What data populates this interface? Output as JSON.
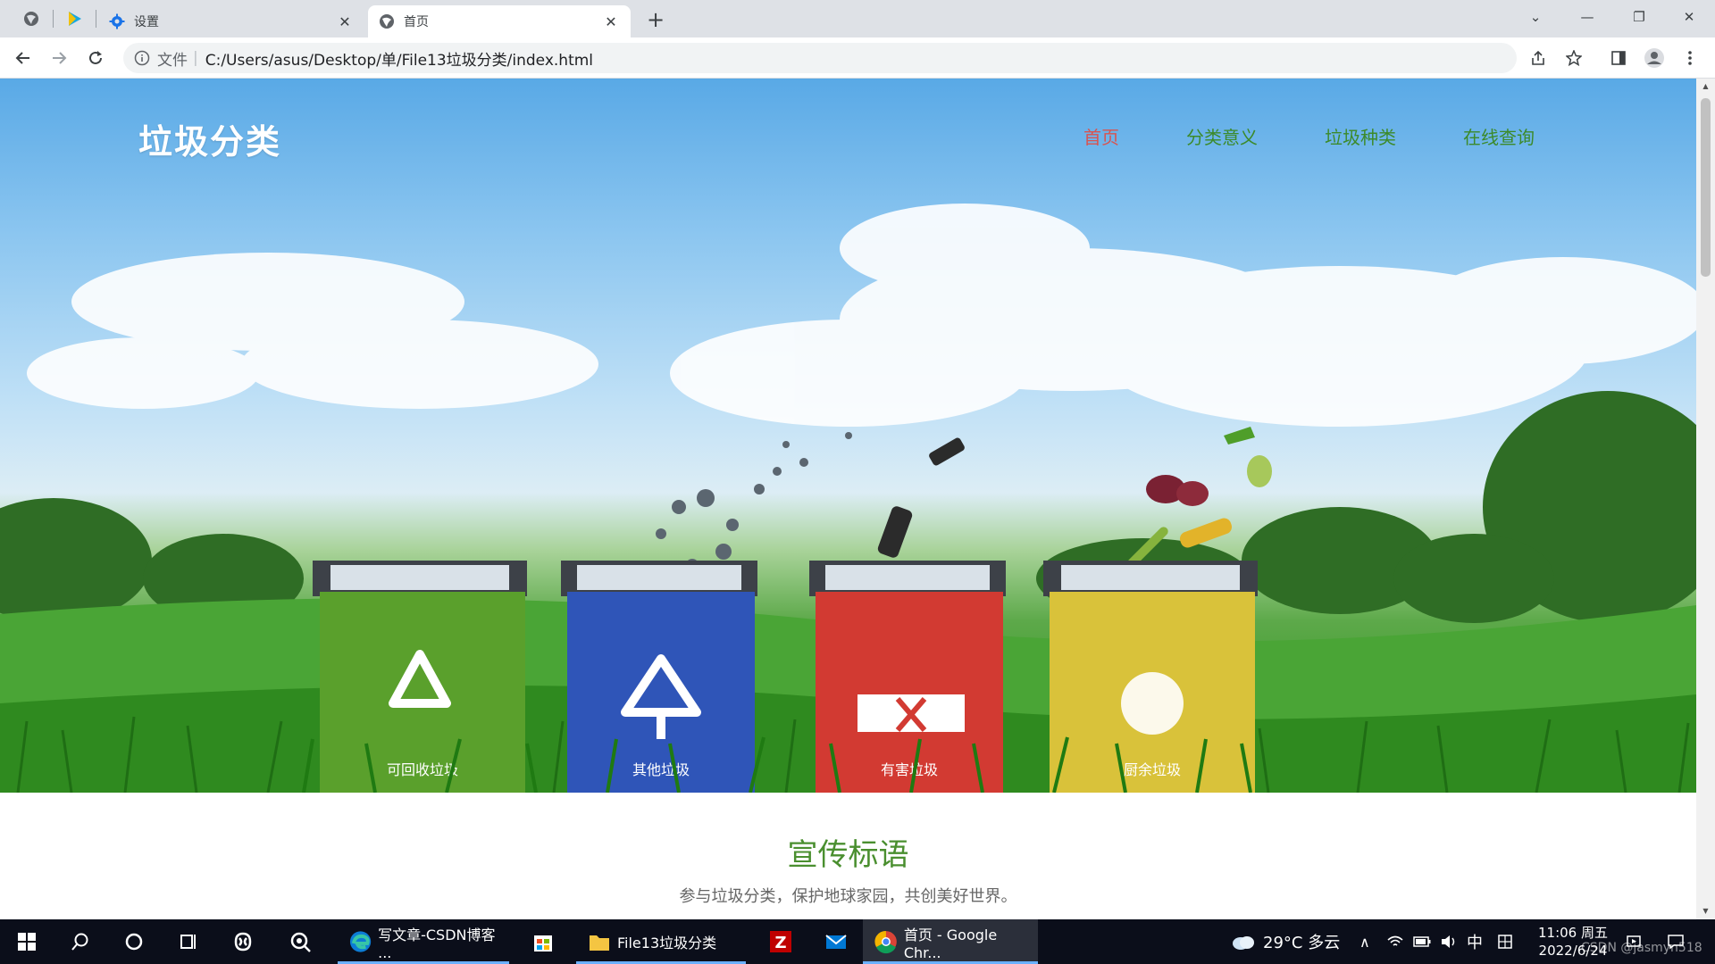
{
  "browser": {
    "tabs": [
      {
        "title": "设置",
        "icon": "gear-icon"
      },
      {
        "title": "首页",
        "icon": "globe-icon",
        "active": true
      }
    ],
    "address": {
      "scheme_label": "文件",
      "url": "C:/Users/asus/Desktop/单/File13垃圾分类/index.html"
    }
  },
  "site": {
    "logo": "垃圾分类",
    "nav": [
      {
        "label": "首页",
        "active": true
      },
      {
        "label": "分类意义"
      },
      {
        "label": "垃圾种类"
      },
      {
        "label": "在线查询"
      }
    ],
    "hero_bins": [
      {
        "label": "可回收垃圾",
        "color": "#5aa02c"
      },
      {
        "label": "其他垃圾",
        "color": "#2f55b8"
      },
      {
        "label": "有害垃圾",
        "color": "#d23a32"
      },
      {
        "label": "厨余垃圾",
        "color": "#d9c23a"
      }
    ],
    "section": {
      "title": "宣传标语",
      "text": "参与垃圾分类，保护地球家园，共创美好世界。"
    }
  },
  "taskbar": {
    "apps": [
      {
        "label": "写文章-CSDN博客 ...",
        "icon": "edge-icon"
      },
      {
        "label": "",
        "icon": "store-icon"
      },
      {
        "label": "File13垃圾分类",
        "icon": "folder-icon"
      },
      {
        "label": "",
        "icon": "filezilla-icon"
      },
      {
        "label": "",
        "icon": "mail-icon"
      },
      {
        "label": "首页 - Google Chr...",
        "icon": "chrome-icon",
        "active": true
      }
    ],
    "weather": "29°C 多云",
    "ime": "中",
    "time": "11:06 周五",
    "date": "2022/6/24",
    "watermark": "CSDN @jasmyn518"
  },
  "colors": {
    "nav_active": "#d9534f",
    "nav": "#3c8a2a",
    "section_title": "#4a8f2f"
  }
}
